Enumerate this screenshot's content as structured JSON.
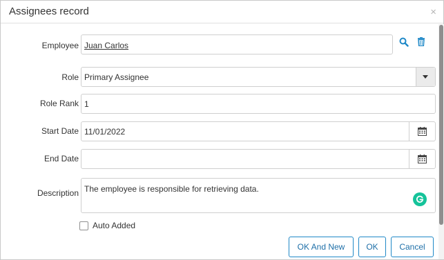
{
  "dialog": {
    "title": "Assignees record",
    "close_glyph": "×"
  },
  "form": {
    "employee": {
      "label": "Employee",
      "value": "Juan Carlos"
    },
    "role": {
      "label": "Role",
      "value": "Primary Assignee"
    },
    "role_rank": {
      "label": "Role Rank",
      "value": "1"
    },
    "start_date": {
      "label": "Start Date",
      "value": "11/01/2022"
    },
    "end_date": {
      "label": "End Date",
      "value": ""
    },
    "description": {
      "label": "Description",
      "value": "The employee is responsible for retrieving data."
    },
    "auto_added": {
      "label": "Auto Added",
      "checked": false
    }
  },
  "buttons": {
    "ok_and_new": "OK And New",
    "ok": "OK",
    "cancel": "Cancel"
  },
  "icons": {
    "search": "search-icon",
    "delete": "trash-icon",
    "calendar": "calendar-icon",
    "dropdown": "chevron-down-icon",
    "grammarly": "grammarly-icon",
    "close": "close-icon"
  },
  "colors": {
    "accent": "#1e88c7",
    "button_text": "#1e6fa8",
    "grammarly": "#15c39a"
  }
}
